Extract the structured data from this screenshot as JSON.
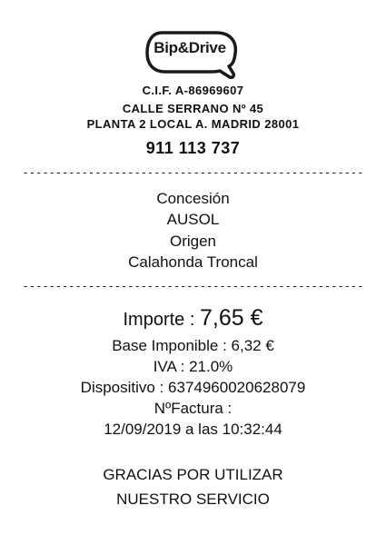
{
  "logo": {
    "text": "Bip&Drive"
  },
  "company": {
    "cif": "C.I.F. A-86969607",
    "address_line1": "CALLE SERRANO Nº 45",
    "address_line2": "PLANTA 2 LOCAL A. MADRID 28001",
    "phone": "911 113 737"
  },
  "divider": "----------------------------------------------------",
  "trip": {
    "concession_label": "Concesión",
    "concession_value": "AUSOL",
    "origin_label": "Origen",
    "origin_value": "Calahonda Troncal"
  },
  "amounts": {
    "importe_label": "Importe : ",
    "importe_value": "7,65 €",
    "base_imponible": "Base Imponible : 6,32 €",
    "iva": "IVA : 21.0%",
    "dispositivo": "Dispositivo : 6374960020628079",
    "factura": "NºFactura :",
    "datetime": "12/09/2019 a las 10:32:44"
  },
  "footer": {
    "line1": "GRACIAS POR UTILIZAR",
    "line2": "NUESTRO SERVICIO"
  }
}
